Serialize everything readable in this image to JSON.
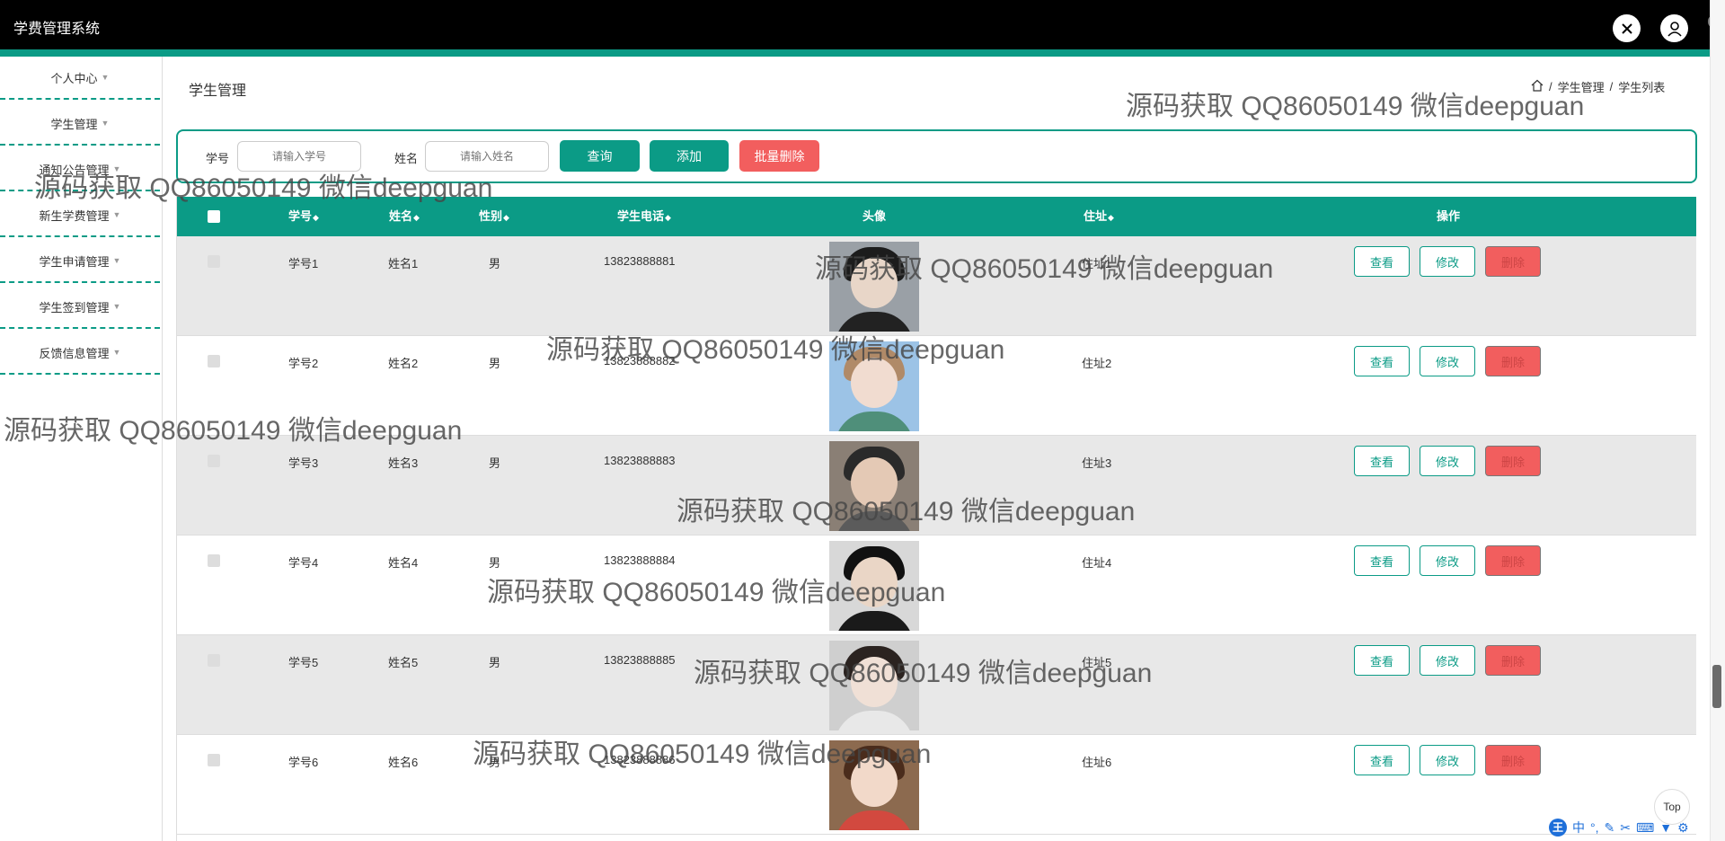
{
  "app": {
    "title": "学费管理系统"
  },
  "sidebar": {
    "items": [
      {
        "label": "个人中心"
      },
      {
        "label": "学生管理"
      },
      {
        "label": "通知公告管理"
      },
      {
        "label": "新生学费管理"
      },
      {
        "label": "学生申请管理"
      },
      {
        "label": "学生签到管理"
      },
      {
        "label": "反馈信息管理"
      }
    ]
  },
  "page": {
    "title": "学生管理",
    "breadcrumb": {
      "sep": "/",
      "level1": "学生管理",
      "level2": "学生列表"
    }
  },
  "search": {
    "id_label": "学号",
    "id_placeholder": "请输入学号",
    "name_label": "姓名",
    "name_placeholder": "请输入姓名",
    "query_label": "查询",
    "add_label": "添加",
    "batch_delete_label": "批量删除"
  },
  "table": {
    "columns": [
      "学号",
      "姓名",
      "性别",
      "学生电话",
      "头像",
      "住址",
      "操作"
    ],
    "rows": [
      {
        "id": "学号1",
        "name": "姓名1",
        "gender": "男",
        "phone": "13823888881",
        "address": "住址1",
        "avatar": "male-black-hair-portrait"
      },
      {
        "id": "学号2",
        "name": "姓名2",
        "gender": "男",
        "phone": "13823888882",
        "address": "住址2",
        "avatar": "female-light-hair-sky-portrait"
      },
      {
        "id": "学号3",
        "name": "姓名3",
        "gender": "男",
        "phone": "13823888883",
        "address": "住址3",
        "avatar": "male-selfie-portrait"
      },
      {
        "id": "学号4",
        "name": "姓名4",
        "gender": "男",
        "phone": "13823888884",
        "address": "住址4",
        "avatar": "male-black-cap-portrait"
      },
      {
        "id": "学号5",
        "name": "姓名5",
        "gender": "男",
        "phone": "13823888885",
        "address": "住址5",
        "avatar": "female-dark-hair-portrait"
      },
      {
        "id": "学号6",
        "name": "姓名6",
        "gender": "男",
        "phone": "13823888886",
        "address": "住址6",
        "avatar": "female-red-shirt-portrait"
      }
    ],
    "actions": {
      "view": "查看",
      "edit": "修改",
      "delete": "删除"
    }
  },
  "watermark": "源码获取 QQ86050149 微信deepguan",
  "corner_text": "e",
  "top_button": "Top",
  "ime": {
    "logo": "王",
    "mode": "中",
    "punct": "°,"
  },
  "colors": {
    "accent": "#0b9b86",
    "danger": "#f25e5e",
    "topbar": "#000000",
    "row_stripe": "#e8e8e8"
  },
  "icons": [
    "close-x-icon",
    "user-avatar-icon",
    "home-icon",
    "sort-arrows-icon",
    "chevron-down-icon"
  ]
}
